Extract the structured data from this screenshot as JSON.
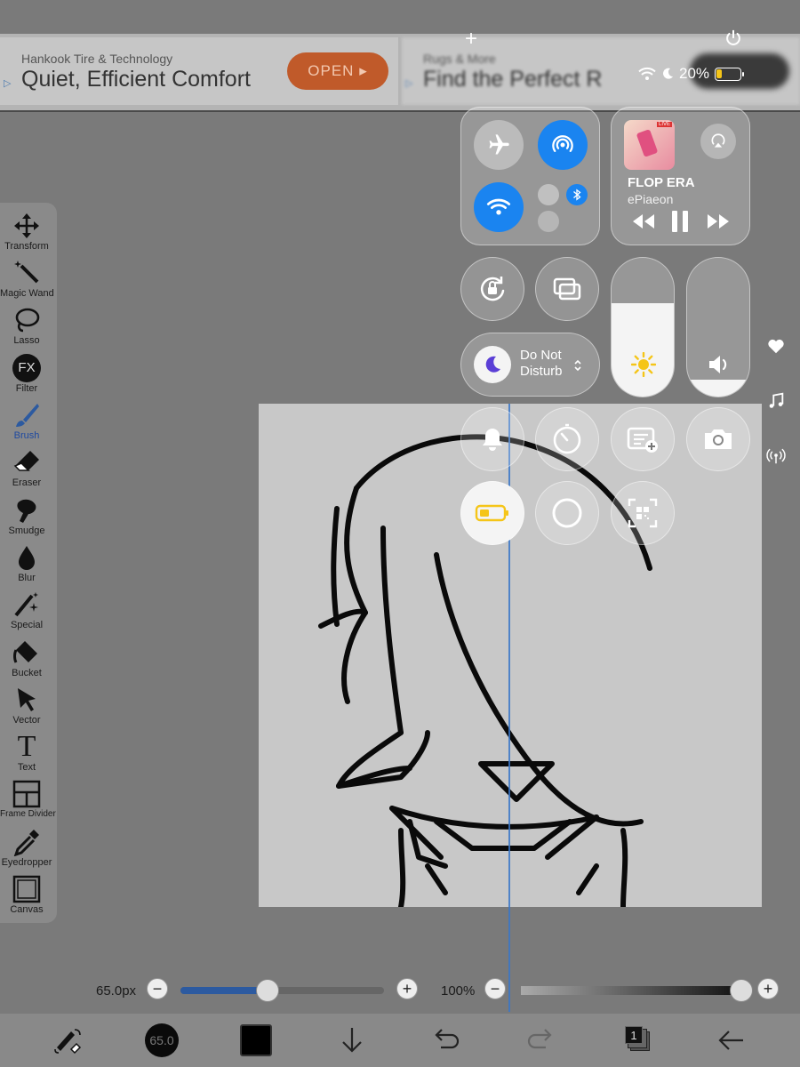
{
  "ad": {
    "card1": {
      "sponsor": "Hankook Tire & Technology",
      "headline": "Quiet, Efficient Comfort",
      "cta": "OPEN",
      "cta_arrow": "▸"
    },
    "card2": {
      "sponsor": "Rugs & More",
      "headline": "Find the Perfect R"
    },
    "ad_mark": "▷"
  },
  "status": {
    "battery": "20%",
    "top_plus": "+"
  },
  "toolbar": {
    "tools": [
      {
        "label": "Transform"
      },
      {
        "label": "Magic Wand"
      },
      {
        "label": "Lasso"
      },
      {
        "label": "Filter",
        "glyph": "FX"
      },
      {
        "label": "Brush"
      },
      {
        "label": "Eraser"
      },
      {
        "label": "Smudge"
      },
      {
        "label": "Blur"
      },
      {
        "label": "Special"
      },
      {
        "label": "Bucket"
      },
      {
        "label": "Vector"
      },
      {
        "label": "Text",
        "glyph": "T"
      },
      {
        "label": "Frame Divider"
      },
      {
        "label": "Eyedropper"
      },
      {
        "label": "Canvas"
      }
    ],
    "active": "Brush"
  },
  "control_center": {
    "now_playing": {
      "title": "FLOP ERA",
      "artist": "ePiaeon",
      "art_badge": "LIVE"
    },
    "focus": {
      "label": "Do Not Disturb"
    },
    "brightness_level": 0.67,
    "volume_level": 0.12
  },
  "bottom": {
    "brush_size": "65.0px",
    "brush_size_level": 0.43,
    "opacity": "100%",
    "opacity_level": 1.0,
    "brush_circle_value": "65.0",
    "layer_count": "1",
    "minus": "−",
    "plus": "+"
  },
  "colors": {
    "accent_blue": "#1a84f0",
    "brush_active": "#1f4aa0",
    "ad_cta": "#c05a2a",
    "battery_low": "#f5c518"
  }
}
